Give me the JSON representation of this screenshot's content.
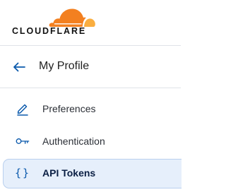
{
  "brand": {
    "name": "CLOUDFLARE",
    "colors": {
      "cloud_primary": "#f38020",
      "cloud_secondary": "#faae40",
      "wordmark": "#111111"
    }
  },
  "profile": {
    "title": "My Profile",
    "back_icon": "arrow-left-icon"
  },
  "nav": {
    "items": [
      {
        "label": "Preferences",
        "icon": "pencil-icon",
        "active": false
      },
      {
        "label": "Authentication",
        "icon": "key-icon",
        "active": false
      },
      {
        "label": "API Tokens",
        "icon": "braces-icon",
        "active": true
      }
    ]
  },
  "colors": {
    "accent": "#0a59ac",
    "active_bg": "#e6effb",
    "active_border": "#b9cfee",
    "divider": "#dfe3e8"
  }
}
